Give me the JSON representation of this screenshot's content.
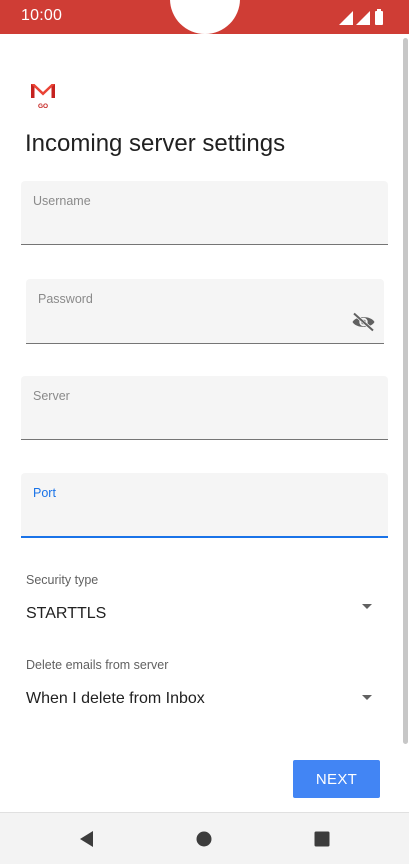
{
  "status_bar": {
    "time": "10:00"
  },
  "app": {
    "logo_icon": "gmail-go-logo",
    "logo_text": "GO",
    "title": "Incoming server settings"
  },
  "form": {
    "username": {
      "label": "Username",
      "value": ""
    },
    "password": {
      "label": "Password",
      "value": "",
      "toggle_icon": "visibility-off-icon"
    },
    "server": {
      "label": "Server",
      "value": ""
    },
    "port": {
      "label": "Port",
      "value": "",
      "focused": true
    },
    "security_type": {
      "label": "Security type",
      "value": "STARTTLS"
    },
    "delete_emails": {
      "label": "Delete emails from server",
      "value": "When I delete from Inbox"
    }
  },
  "actions": {
    "next_label": "NEXT"
  },
  "colors": {
    "status_bar": "#cf3d35",
    "accent": "#1a73e8",
    "button": "#4285f4"
  },
  "nav": {
    "back_icon": "back-triangle-icon",
    "home_icon": "home-circle-icon",
    "recents_icon": "recents-square-icon"
  }
}
